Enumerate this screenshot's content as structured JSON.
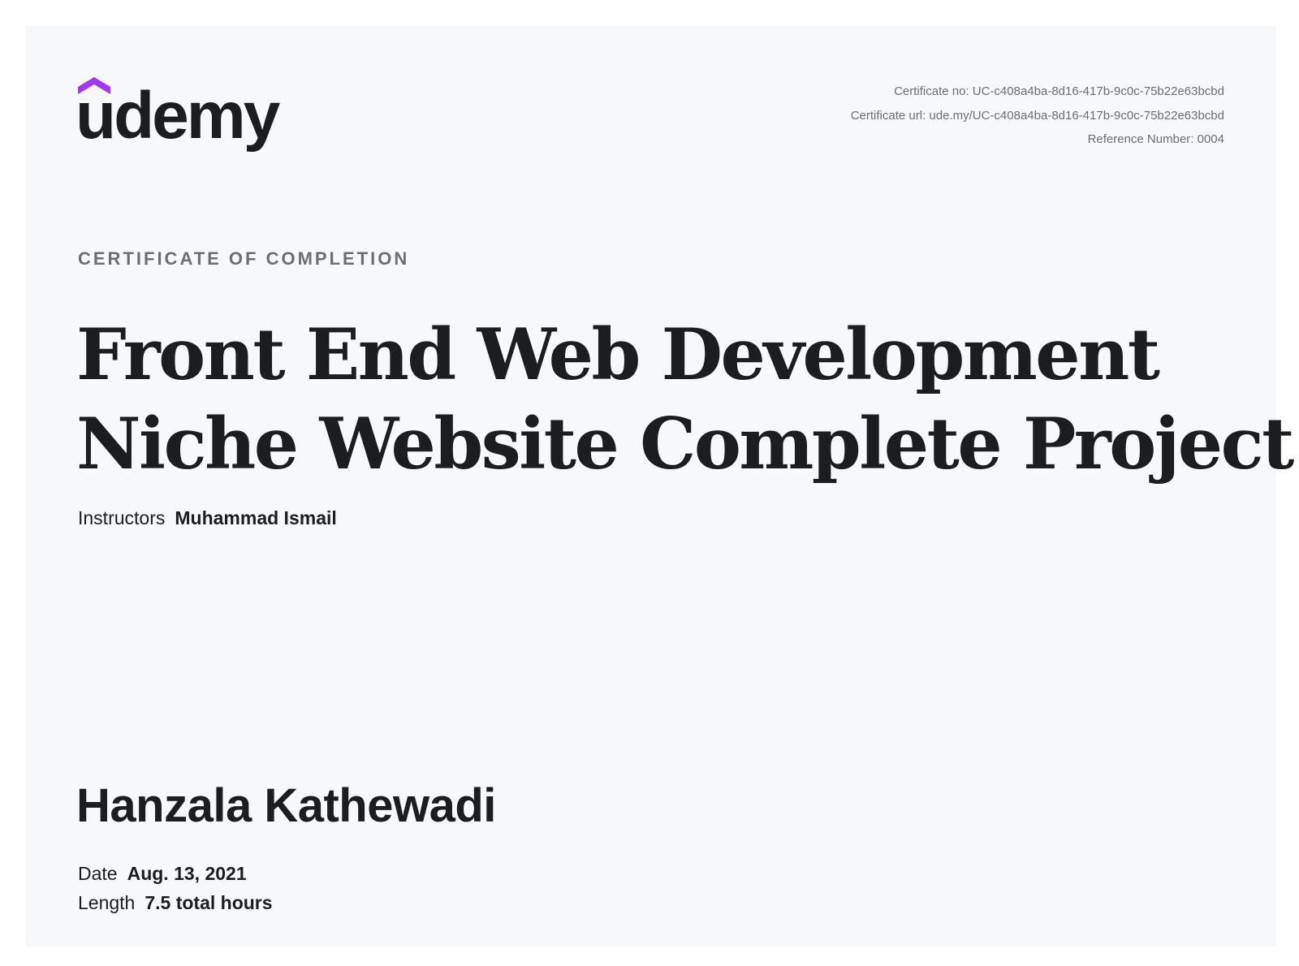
{
  "brand": {
    "name": "udemy",
    "accent_color": "#a435f0",
    "text_color": "#1c1d1f"
  },
  "certificate_meta": {
    "number": "Certificate no: UC-c408a4ba-8d16-417b-9c0c-75b22e63bcbd",
    "url": "Certificate url: ude.my/UC-c408a4ba-8d16-417b-9c0c-75b22e63bcbd",
    "reference": "Reference Number: 0004"
  },
  "heading": "CERTIFICATE OF COMPLETION",
  "course": {
    "title_line_1": "Front End Web Development",
    "title_line_2": "Niche Website Complete Project"
  },
  "instructors": {
    "label": "Instructors",
    "value": "Muhammad Ismail"
  },
  "recipient": "Hanzala Kathewadi",
  "details": {
    "date_label": "Date",
    "date_value": "Aug. 13, 2021",
    "length_label": "Length",
    "length_value": "7.5 total hours"
  }
}
